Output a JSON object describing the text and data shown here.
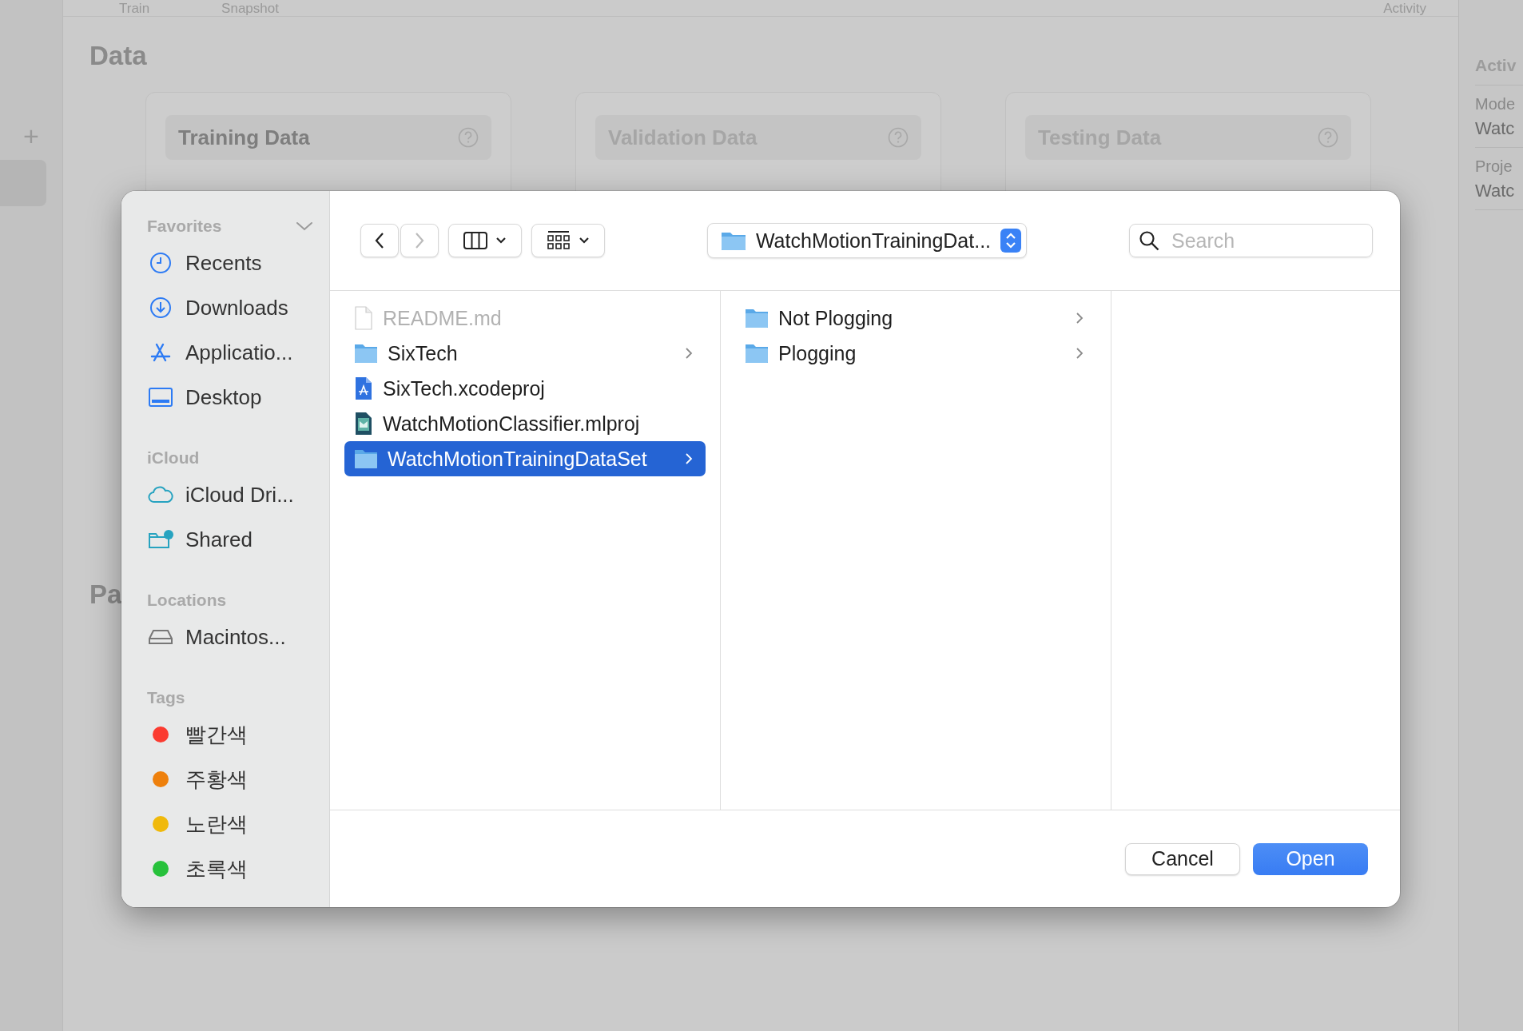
{
  "background_app": {
    "tabs": [
      {
        "label": "Train"
      },
      {
        "label": "Snapshot"
      }
    ],
    "activity_tab": "Activity",
    "add_label": "+",
    "data_section": {
      "heading": "Data",
      "cards": [
        {
          "title": "Training Data",
          "disabled": false
        },
        {
          "title": "Validation Data",
          "disabled": true
        },
        {
          "title": "Testing Data",
          "disabled": true
        }
      ]
    },
    "next_heading": "Pa",
    "inspector": {
      "heading": "Activ",
      "fields": [
        {
          "label": "Mode",
          "value": "Watc"
        },
        {
          "label": "Proje",
          "value": "Watc"
        }
      ]
    }
  },
  "dialog": {
    "sidebar": [
      {
        "title": "Favorites",
        "collapsible": true,
        "items": [
          {
            "label": "Recents",
            "kind": "clock"
          },
          {
            "label": "Downloads",
            "kind": "download"
          },
          {
            "label": "Applicatio...",
            "kind": "apps"
          },
          {
            "label": "Desktop",
            "kind": "desktop"
          }
        ]
      },
      {
        "title": "iCloud",
        "collapsible": false,
        "items": [
          {
            "label": "iCloud Dri...",
            "kind": "cloud"
          },
          {
            "label": "Shared",
            "kind": "shared"
          }
        ]
      },
      {
        "title": "Locations",
        "collapsible": false,
        "items": [
          {
            "label": "Macintos...",
            "kind": "drive"
          }
        ]
      },
      {
        "title": "Tags",
        "collapsible": false,
        "items": [
          {
            "label": "빨간색",
            "kind": "tag",
            "color": "#fb3b30"
          },
          {
            "label": "주황색",
            "kind": "tag",
            "color": "#ee800c"
          },
          {
            "label": "노란색",
            "kind": "tag",
            "color": "#f0b90b"
          },
          {
            "label": "초록색",
            "kind": "tag",
            "color": "#27c13b"
          }
        ]
      }
    ],
    "toolbar": {
      "back_disabled": false,
      "forward_disabled": true,
      "path": "WatchMotionTrainingDat...",
      "search_placeholder": "Search"
    },
    "columns": [
      {
        "items": [
          {
            "name": "README.md",
            "kind": "document",
            "disabled": true,
            "expandable": false,
            "selected": false
          },
          {
            "name": "SixTech",
            "kind": "folder",
            "disabled": false,
            "expandable": true,
            "selected": false
          },
          {
            "name": "SixTech.xcodeproj",
            "kind": "xcodeproj",
            "disabled": false,
            "expandable": false,
            "selected": false
          },
          {
            "name": "WatchMotionClassifier.mlproj",
            "kind": "mlproj",
            "disabled": false,
            "expandable": false,
            "selected": false
          },
          {
            "name": "WatchMotionTrainingDataSet",
            "kind": "folder",
            "disabled": false,
            "expandable": true,
            "selected": true
          }
        ]
      },
      {
        "items": [
          {
            "name": "Not Plogging",
            "kind": "folder",
            "disabled": false,
            "expandable": true,
            "selected": false
          },
          {
            "name": "Plogging",
            "kind": "folder",
            "disabled": false,
            "expandable": true,
            "selected": false
          }
        ]
      }
    ],
    "buttons": [
      {
        "label": "Cancel",
        "kind": "secondary"
      },
      {
        "label": "Open",
        "kind": "primary"
      }
    ]
  }
}
